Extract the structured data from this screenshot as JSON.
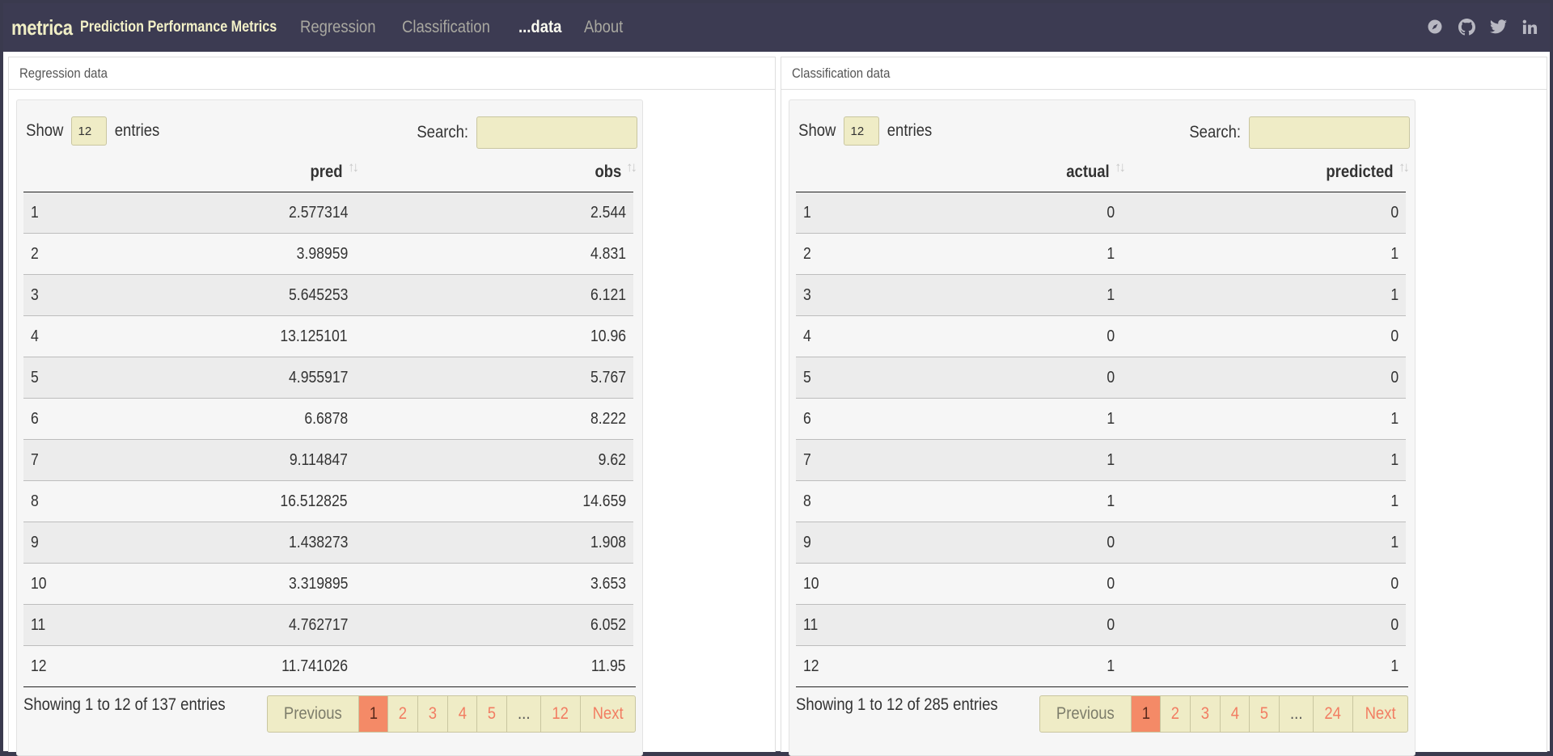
{
  "navbar": {
    "brand": "metrica",
    "subtitle": "Prediction Performance Metrics",
    "links": [
      "Regression",
      "Classification",
      "...data",
      "About"
    ],
    "active_link": "...data",
    "icons": [
      "compass-icon",
      "github-icon",
      "twitter-icon",
      "linkedin-icon"
    ]
  },
  "regression": {
    "panel_title": "Regression data",
    "show_label": "Show",
    "entries_value": "12",
    "entries_label": "entries",
    "search_label": "Search:",
    "search_value": "",
    "columns": [
      "",
      "pred",
      "obs"
    ],
    "rows": [
      [
        "1",
        "2.577314",
        "2.544"
      ],
      [
        "2",
        "3.98959",
        "4.831"
      ],
      [
        "3",
        "5.645253",
        "6.121"
      ],
      [
        "4",
        "13.125101",
        "10.96"
      ],
      [
        "5",
        "4.955917",
        "5.767"
      ],
      [
        "6",
        "6.6878",
        "8.222"
      ],
      [
        "7",
        "9.114847",
        "9.62"
      ],
      [
        "8",
        "16.512825",
        "14.659"
      ],
      [
        "9",
        "1.438273",
        "1.908"
      ],
      [
        "10",
        "3.319895",
        "3.653"
      ],
      [
        "11",
        "4.762717",
        "6.052"
      ],
      [
        "12",
        "11.741026",
        "11.95"
      ]
    ],
    "info": "Showing 1 to 12 of 137 entries",
    "pagination": [
      "Previous",
      "1",
      "2",
      "3",
      "4",
      "5",
      "...",
      "12",
      "Next"
    ],
    "current_page": "1"
  },
  "classification": {
    "panel_title": "Classification data",
    "show_label": "Show",
    "entries_value": "12",
    "entries_label": "entries",
    "search_label": "Search:",
    "search_value": "",
    "columns": [
      "",
      "actual",
      "predicted"
    ],
    "rows": [
      [
        "1",
        "0",
        "0"
      ],
      [
        "2",
        "1",
        "1"
      ],
      [
        "3",
        "1",
        "1"
      ],
      [
        "4",
        "0",
        "0"
      ],
      [
        "5",
        "0",
        "0"
      ],
      [
        "6",
        "1",
        "1"
      ],
      [
        "7",
        "1",
        "1"
      ],
      [
        "8",
        "1",
        "1"
      ],
      [
        "9",
        "0",
        "1"
      ],
      [
        "10",
        "0",
        "0"
      ],
      [
        "11",
        "0",
        "0"
      ],
      [
        "12",
        "1",
        "1"
      ]
    ],
    "info": "Showing 1 to 12 of 285 entries",
    "pagination": [
      "Previous",
      "1",
      "2",
      "3",
      "4",
      "5",
      "...",
      "24",
      "Next"
    ],
    "current_page": "1"
  },
  "colors": {
    "navbar_bg": "#3c3b52",
    "brand": "#f0eec5",
    "input_bg": "#efecc6",
    "accent": "#f48a67",
    "link_text": "#f27d62"
  }
}
